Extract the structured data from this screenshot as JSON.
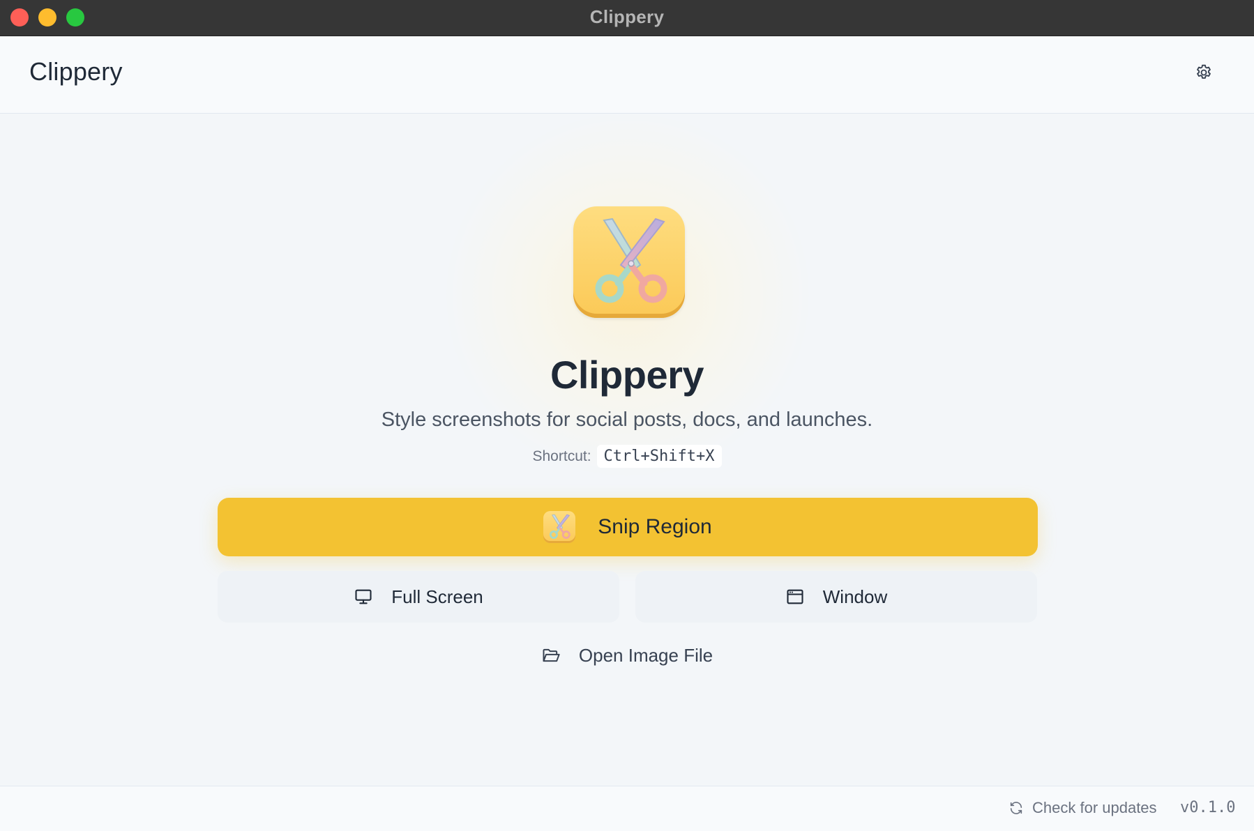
{
  "window": {
    "title": "Clippery"
  },
  "header": {
    "app_name": "Clippery",
    "settings_icon": "gear-icon"
  },
  "hero": {
    "app_icon": "scissors-icon",
    "title": "Clippery",
    "tagline": "Style screenshots for social posts, docs, and launches.",
    "shortcut_label": "Shortcut:",
    "shortcut_keys": "Ctrl+Shift+X"
  },
  "actions": {
    "snip_region": {
      "label": "Snip Region",
      "icon": "scissors-icon"
    },
    "full_screen": {
      "label": "Full Screen",
      "icon": "monitor-icon"
    },
    "window": {
      "label": "Window",
      "icon": "window-icon"
    },
    "open_image": {
      "label": "Open Image File",
      "icon": "folder-open-icon"
    }
  },
  "footer": {
    "update_label": "Check for updates",
    "update_icon": "refresh-icon",
    "version": "v0.1.0"
  },
  "colors": {
    "accent": "#f3c232",
    "title_bar": "#363636",
    "background": "#f3f6f9"
  }
}
